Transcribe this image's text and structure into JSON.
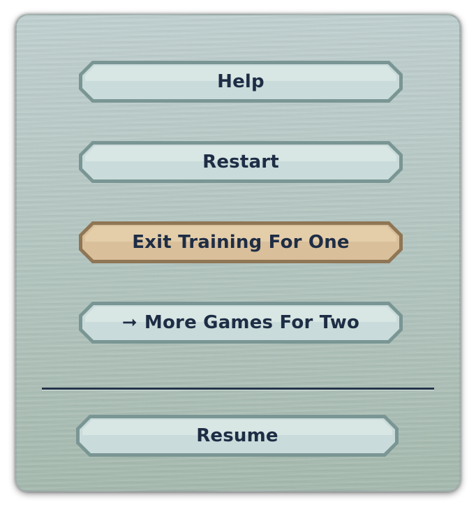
{
  "menu": {
    "buttons": [
      {
        "id": "help",
        "label": "Help"
      },
      {
        "id": "restart",
        "label": "Restart"
      },
      {
        "id": "exit",
        "label": "Exit Training For One",
        "highlighted": true
      },
      {
        "id": "more-games",
        "label": "More Games For Two",
        "icon": "arrow-right-icon",
        "icon_glyph": "➞"
      }
    ],
    "resume": {
      "label": "Resume"
    }
  },
  "colors": {
    "panel": "#b4c6c1",
    "button_fill": "#c9dbda",
    "button_border": "#7a9694",
    "highlight_fill": "#d9bf9a",
    "highlight_border": "#8f7655",
    "text": "#1e2d45",
    "divider": "#233447"
  }
}
